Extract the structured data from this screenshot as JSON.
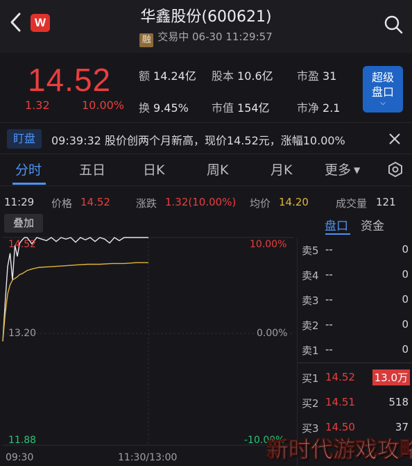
{
  "header": {
    "title": "华鑫股份(600621)",
    "badge": "融",
    "status": "交易中 06-30 11:29:57",
    "logo": "W"
  },
  "quote": {
    "price": "14.52",
    "change": "1.32",
    "change_pct": "10.00%",
    "stats": [
      {
        "label": "额",
        "value": "14.24亿"
      },
      {
        "label": "股本",
        "value": "10.6亿"
      },
      {
        "label": "市盈",
        "value": "31"
      },
      {
        "label": "换",
        "value": "9.45%"
      },
      {
        "label": "市值",
        "value": "154亿"
      },
      {
        "label": "市净",
        "value": "2.1"
      }
    ],
    "super_button": {
      "line1": "超级",
      "line2": "盘口"
    }
  },
  "news": {
    "tag": "盯盘",
    "text": "09:39:32 股价创两个月新高，现价14.52元，涨幅10.00%"
  },
  "tabs": [
    "分时",
    "五日",
    "日K",
    "周K",
    "月K",
    "更多"
  ],
  "info": {
    "time": "11:29",
    "price_label": "价格",
    "price_value": "14.52",
    "chg_label": "涨跌",
    "chg_value": "1.32(10.00%)",
    "avg_label": "均价",
    "avg_value": "14.20",
    "vol_label": "成交量",
    "vol_value": "121"
  },
  "overlay_button": "叠加",
  "chart_data": {
    "type": "line",
    "x_ticks": [
      "09:30",
      "11:30/13:00"
    ],
    "y_ticks_left": [
      "14.52",
      "13.20",
      "11.88"
    ],
    "y_ticks_right": [
      "10.00%",
      "0.00%",
      "-10.00%"
    ],
    "ylim": [
      11.88,
      14.52
    ],
    "series": [
      {
        "x": [
          0,
          2,
          4,
          6,
          8,
          10,
          12,
          14,
          16,
          18,
          20,
          24,
          28,
          32,
          36,
          40,
          44,
          48,
          52,
          56,
          60,
          64,
          68,
          72,
          76,
          80,
          84,
          88,
          92,
          96,
          100,
          104,
          108,
          120
        ],
        "values": [
          13.2,
          13.7,
          14.15,
          14.32,
          13.98,
          14.42,
          14.28,
          14.45,
          14.49,
          14.52,
          14.52,
          14.44,
          14.52,
          14.5,
          14.48,
          14.52,
          14.47,
          14.52,
          14.5,
          14.52,
          14.46,
          14.52,
          14.49,
          14.52,
          14.47,
          14.52,
          14.5,
          14.45,
          14.52,
          14.48,
          14.52,
          14.52,
          14.52,
          14.52
        ]
      },
      {
        "x": [
          0,
          2,
          4,
          6,
          8,
          10,
          12,
          14,
          16,
          18,
          20,
          24,
          30,
          40,
          50,
          60,
          70,
          80,
          90,
          100,
          110,
          120
        ],
        "values": [
          13.2,
          13.55,
          13.8,
          13.92,
          13.98,
          14.0,
          14.02,
          14.05,
          14.06,
          14.08,
          14.1,
          14.12,
          14.14,
          14.15,
          14.16,
          14.17,
          14.18,
          14.18,
          14.19,
          14.19,
          14.2,
          14.2
        ]
      }
    ]
  },
  "order_book": {
    "tabs": [
      "盘口",
      "资金"
    ],
    "asks": [
      {
        "label": "卖5",
        "price": "--",
        "vol": "0"
      },
      {
        "label": "卖4",
        "price": "--",
        "vol": "0"
      },
      {
        "label": "卖3",
        "price": "--",
        "vol": "0"
      },
      {
        "label": "卖2",
        "price": "--",
        "vol": "0"
      },
      {
        "label": "卖1",
        "price": "--",
        "vol": "0"
      }
    ],
    "bids": [
      {
        "label": "买1",
        "price": "14.52",
        "vol": "13.0万"
      },
      {
        "label": "买2",
        "price": "14.51",
        "vol": "518"
      },
      {
        "label": "买3",
        "price": "14.50",
        "vol": "37"
      }
    ]
  },
  "watermark": "新时代游戏攻略",
  "colors": {
    "up": "#ea3e3e",
    "accent": "#4f93f5",
    "avg_line": "#e0b43a"
  }
}
